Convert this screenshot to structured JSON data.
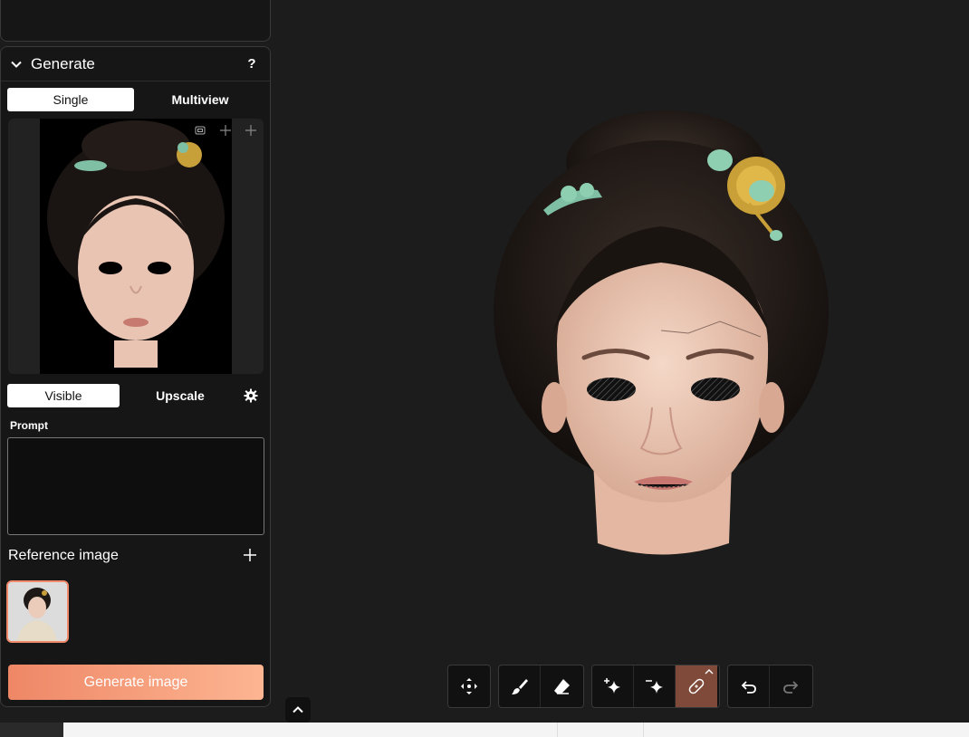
{
  "generate_panel": {
    "title": "Generate",
    "help_label": "?",
    "mode_tabs": [
      {
        "label": "Single",
        "active": true
      },
      {
        "label": "Multiview",
        "active": false
      }
    ],
    "view_tabs": [
      {
        "label": "Visible",
        "active": true
      },
      {
        "label": "Upscale",
        "active": false
      }
    ],
    "prompt": {
      "label": "Prompt",
      "value": "",
      "placeholder": ""
    },
    "reference": {
      "label": "Reference image"
    },
    "generate_button_label": "Generate image"
  },
  "toolbar": {
    "groups": [
      [
        "move-icon"
      ],
      [
        "brush-icon",
        "eraser-icon"
      ],
      [
        "sparkle-add-icon",
        "sparkle-remove-icon",
        "bandage-icon"
      ],
      [
        "undo-icon",
        "redo-icon"
      ]
    ]
  },
  "colors": {
    "accent_start": "#ee8766",
    "accent_end": "#fdb592",
    "active_tool": "#7f4a3a",
    "background": "#1c1c1c",
    "panel": "#161616"
  }
}
